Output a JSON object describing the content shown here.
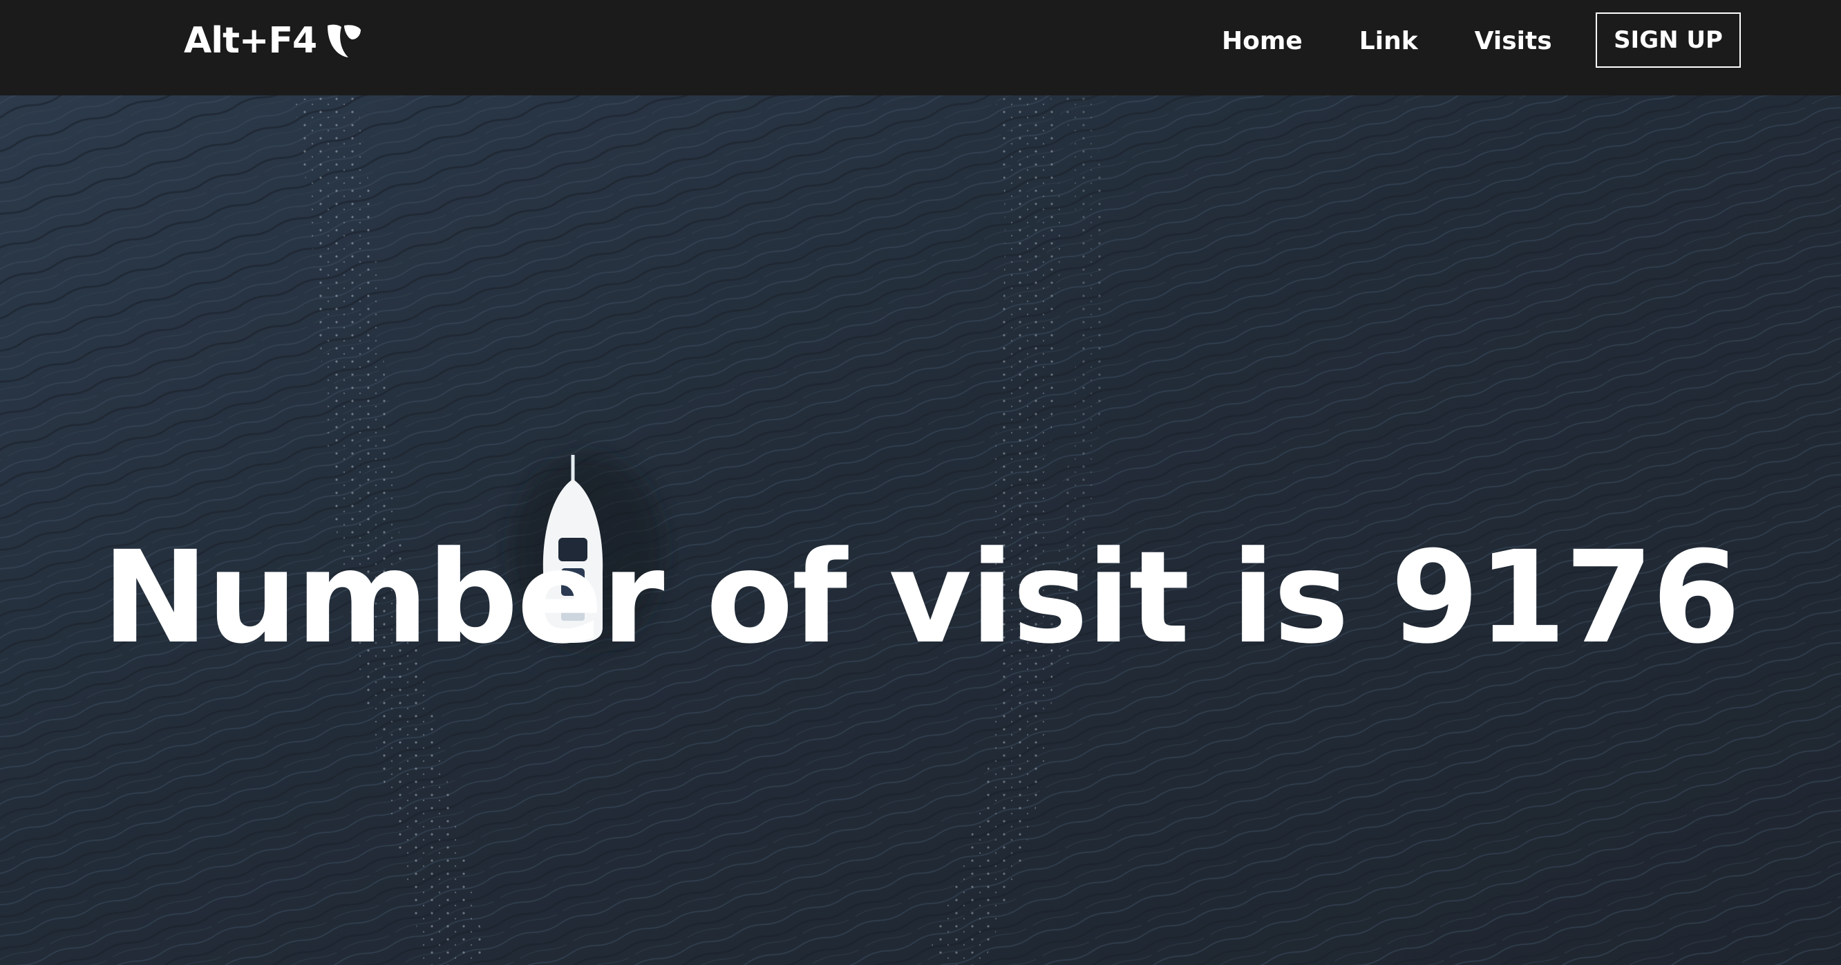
{
  "navbar": {
    "brand_text": "Alt+F4",
    "brand_logo_icon": "typo3-logo-icon",
    "links": [
      {
        "label": "Home"
      },
      {
        "label": "Link"
      },
      {
        "label": "Visits"
      }
    ],
    "signup_label": "SIGN UP"
  },
  "hero": {
    "heading": "Number of visit is 9176",
    "background": "aerial-ocean-boat-photo"
  },
  "colors": {
    "navbar_bg": "#1b1b1b",
    "text": "#ffffff",
    "water": "#26303d"
  }
}
